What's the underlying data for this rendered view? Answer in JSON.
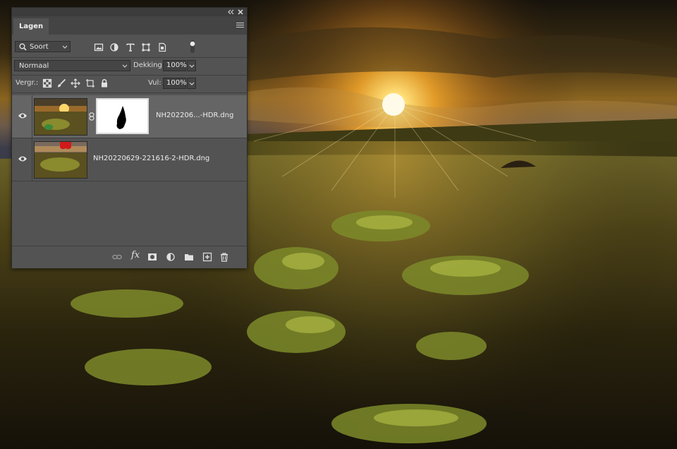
{
  "panel": {
    "title": "Lagen",
    "collapse_icon": "double-chevron-left-icon",
    "close_icon": "close-icon",
    "menu_icon": "hamburger-menu-icon"
  },
  "filter": {
    "kind_label": "Soort",
    "icons": [
      "image-filter-icon",
      "adjustment-filter-icon",
      "type-filter-icon",
      "shape-filter-icon",
      "smart-object-filter-icon",
      "filter-toggle-icon"
    ]
  },
  "blend": {
    "mode": "Normaal",
    "opacity_label": "Dekking:",
    "opacity_value": "100%"
  },
  "lock": {
    "label": "Vergr.:",
    "fill_label": "Vul:",
    "fill_value": "100%",
    "icons": [
      "lock-transparent-pixels-icon",
      "lock-image-pixels-icon",
      "lock-position-icon",
      "lock-artboard-icon",
      "lock-all-icon"
    ]
  },
  "layers": [
    {
      "name": "NH202206...-HDR.dng",
      "visible": true,
      "selected": true,
      "has_mask": true
    },
    {
      "name": "NH20220629-221616-2-HDR.dng",
      "visible": true,
      "selected": false,
      "has_mask": false
    }
  ],
  "footer": {
    "fx_label": "fx",
    "icons": [
      "link-layers-icon",
      "layer-style-icon",
      "add-mask-icon",
      "adjustment-layer-icon",
      "group-folder-icon",
      "new-layer-icon",
      "trash-icon"
    ]
  },
  "colors": {
    "panel_bg": "#535353",
    "selected_row": "#656565",
    "sun": "#ffd24a"
  }
}
